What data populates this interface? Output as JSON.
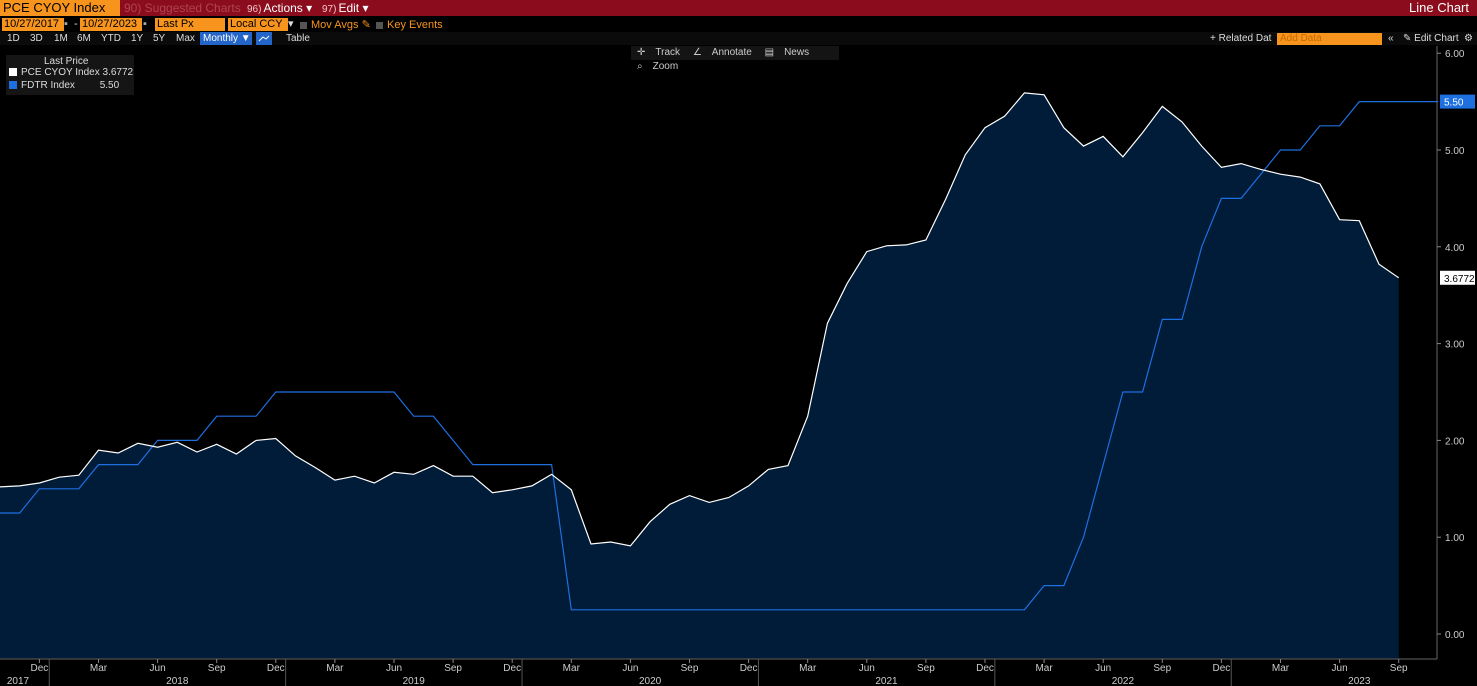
{
  "header": {
    "ticker": "PCE CYOY Index",
    "suggested": "90) Suggested Charts",
    "actions_num": "96)",
    "actions": "Actions",
    "edit_num": "97)",
    "edit": "Edit",
    "chart_type": "Line Chart"
  },
  "controls": {
    "start_date": "10/27/2017",
    "end_date": "10/27/2023",
    "price_field": "Last Px",
    "currency": "Local CCY",
    "mov_avgs": "Mov Avgs",
    "key_events": "Key Events",
    "ranges": [
      "1D",
      "3D",
      "1M",
      "6M",
      "YTD",
      "1Y",
      "5Y",
      "Max"
    ],
    "period": "Monthly ▼",
    "table": "Table",
    "related_data": "+ Related Dat",
    "add_data_placeholder": "Add Data",
    "edit_chart": "Edit Chart"
  },
  "toolbar": {
    "track": "Track",
    "annotate": "Annotate",
    "news": "News",
    "zoom": "Zoom"
  },
  "legend": {
    "title": "Last Price",
    "items": [
      {
        "label": "PCE CYOY Index",
        "value": "3.6772",
        "color": "#ffffff"
      },
      {
        "label": "FDTR Index",
        "value": "5.50",
        "color": "#1e6fe0"
      }
    ]
  },
  "chart_data": {
    "type": "line",
    "ylim": [
      -0.25,
      6.0
    ],
    "y_ticks": [
      "0.00",
      "1.00",
      "2.00",
      "3.00",
      "4.00",
      "5.00",
      "6.00"
    ],
    "x_month_labels": [
      "Dec",
      "Mar",
      "Jun",
      "Sep",
      "Dec",
      "Mar",
      "Jun",
      "Sep",
      "Dec",
      "Mar",
      "Jun",
      "Sep",
      "Dec",
      "Mar",
      "Jun",
      "Sep",
      "Dec",
      "Mar",
      "Jun",
      "Sep",
      "Dec",
      "Mar",
      "Jun",
      "Sep"
    ],
    "x_year_labels": [
      "2017",
      "2018",
      "2019",
      "2020",
      "2021",
      "2022",
      "2023"
    ],
    "start": "2017-10",
    "series": [
      {
        "name": "PCE CYOY Index",
        "color": "#ffffff",
        "fill": "#001c38",
        "last_value_label": "3.6772",
        "x_start": "2017-10",
        "values": [
          1.52,
          1.53,
          1.56,
          1.62,
          1.64,
          1.9,
          1.87,
          1.97,
          1.93,
          1.98,
          1.88,
          1.96,
          1.86,
          2.0,
          2.02,
          1.84,
          1.72,
          1.59,
          1.63,
          1.56,
          1.67,
          1.65,
          1.74,
          1.63,
          1.63,
          1.46,
          1.49,
          1.53,
          1.65,
          1.49,
          0.93,
          0.95,
          0.91,
          1.16,
          1.34,
          1.43,
          1.36,
          1.41,
          1.53,
          1.7,
          1.74,
          2.25,
          3.21,
          3.62,
          3.95,
          4.01,
          4.02,
          4.07,
          4.49,
          4.95,
          5.23,
          5.35,
          5.59,
          5.57,
          5.23,
          5.04,
          5.14,
          4.93,
          5.18,
          5.45,
          5.29,
          5.04,
          4.82,
          4.86,
          4.8,
          4.75,
          4.72,
          4.65,
          4.28,
          4.27,
          3.82,
          3.68
        ]
      },
      {
        "name": "FDTR Index",
        "color": "#1e6fe0",
        "last_value_label": "5.50",
        "x_start": "2017-10",
        "values": [
          1.25,
          1.25,
          1.5,
          1.5,
          1.5,
          1.75,
          1.75,
          1.75,
          2.0,
          2.0,
          2.0,
          2.25,
          2.25,
          2.25,
          2.5,
          2.5,
          2.5,
          2.5,
          2.5,
          2.5,
          2.5,
          2.25,
          2.25,
          2.0,
          1.75,
          1.75,
          1.75,
          1.75,
          1.75,
          0.25,
          0.25,
          0.25,
          0.25,
          0.25,
          0.25,
          0.25,
          0.25,
          0.25,
          0.25,
          0.25,
          0.25,
          0.25,
          0.25,
          0.25,
          0.25,
          0.25,
          0.25,
          0.25,
          0.25,
          0.25,
          0.25,
          0.25,
          0.25,
          0.5,
          0.5,
          1.0,
          1.75,
          2.5,
          2.5,
          3.25,
          3.25,
          4.0,
          4.5,
          4.5,
          4.75,
          5.0,
          5.0,
          5.25,
          5.25,
          5.5,
          5.5,
          5.5,
          5.5,
          5.5
        ]
      }
    ]
  }
}
